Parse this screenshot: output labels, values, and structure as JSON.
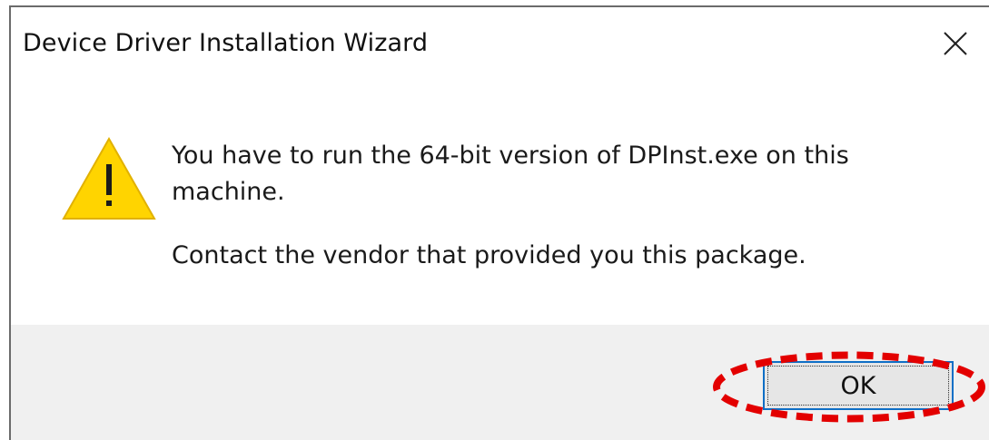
{
  "dialog": {
    "title": "Device Driver Installation Wizard",
    "close_icon": "close-icon",
    "warning_icon": "warning-icon",
    "message_line1": "You have to run the 64-bit version of DPInst.exe on this machine.",
    "message_line2": "Contact the vendor that provided you this package.",
    "ok_label": "OK"
  },
  "annotation": {
    "highlight_color": "#e30000",
    "highlight_style": "dashed-ellipse"
  },
  "colors": {
    "title_bar": "#ffffff",
    "footer": "#f0f0f0",
    "button_border": "#0f6fc6",
    "warning_fill": "#ffd400"
  }
}
